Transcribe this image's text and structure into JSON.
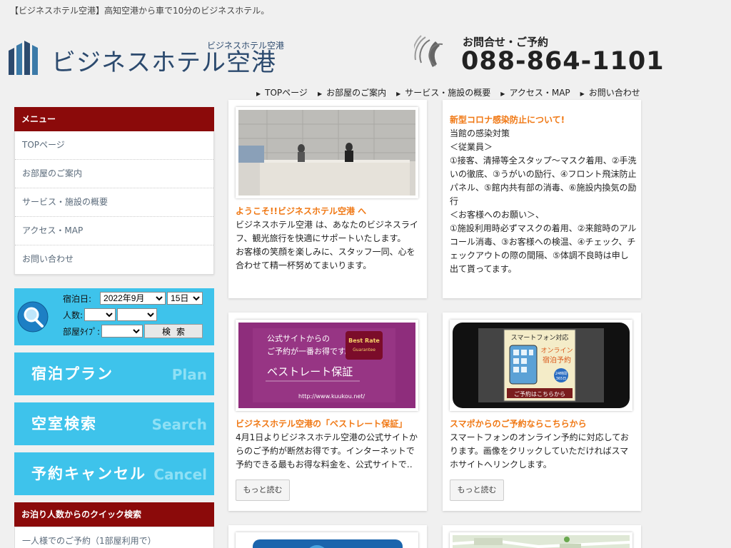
{
  "site": {
    "tagline": "【ビジネスホテル空港】高知空港から車で10分のビジネスホテル。",
    "logo_sub": "ビジネスホテル空港",
    "logo_name": "ビジネスホテル空港",
    "phone_label": "お問合せ・ご予約",
    "phone_number": "088-864-1101"
  },
  "topnav": [
    {
      "label": "TOPページ"
    },
    {
      "label": "お部屋のご案内"
    },
    {
      "label": "サービス・施設の概要"
    },
    {
      "label": "アクセス・MAP"
    },
    {
      "label": "お問い合わせ"
    }
  ],
  "sidebar": {
    "menu_head": "メニュー",
    "items": [
      {
        "label": "TOPページ"
      },
      {
        "label": "お部屋のご案内"
      },
      {
        "label": "サービス・施設の概要"
      },
      {
        "label": "アクセス・MAP"
      },
      {
        "label": "お問い合わせ"
      }
    ]
  },
  "search": {
    "date_label": "宿泊日:",
    "month_value": "2022年9月",
    "day_value": "15日",
    "people_label": "人数:",
    "room_label": "部屋ﾀｲﾌﾟ:",
    "button": "検索"
  },
  "big_buttons": [
    {
      "jp": "宿泊プラン",
      "en": "Plan"
    },
    {
      "jp": "空室検索",
      "en": "Search"
    },
    {
      "jp": "予約キャンセル",
      "en": "Cancel"
    }
  ],
  "quick": {
    "head": "お泊り人数からのクイック検索",
    "items": [
      {
        "label": "一人様でのご予約（1部屋利用で）"
      }
    ]
  },
  "cards": {
    "welcome": {
      "title": "ようこそ!!ビジネスホテル空港 へ",
      "body": "ビジネスホテル空港 は、あなたのビジネスライフ、観光旅行を快適にサポートいたします。\nお客様の笑顔を楽しみに、スタッフ一同、心を合わせて精一杯努めてまいります。"
    },
    "notice": {
      "title": "新型コロナ感染防止について!",
      "body": "当館の感染対策\n＜従業員＞\n①接客、清掃等全スタップ～マスク着用、②手洗いの徹底、③うがいの励行、④フロント飛沫防止パネル、⑤館内共有部の消毒、⑥施設内換気の励行\n＜お客様へのお願い＞、\n①施設利用時必ずマスクの着用、②来館時のアルコール消毒、③お客様への検温、④チェック、チェックアウトの際の間隔、⑤体調不良時は申し出て貰ってます。"
    },
    "bestrate": {
      "title": "ビジネスホテル空港の「ベストレート保証」",
      "body": "4月1日よりビジネスホテル空港の公式サイトからのご予約が断然お得です。インターネットで予約できる最もお得な料金を、公式サイトで‥",
      "more": "もっと読む",
      "img_line1": "公式サイトからの",
      "img_line2": "ご予約が一番お得です。",
      "img_main": "ベストレート保証",
      "img_url": "http://www.kuukou.net/",
      "badge1": "Best Rate",
      "badge2": "Guarantee"
    },
    "smartphone": {
      "title": "スマポからのご予約ならこちらから",
      "body": "スマートフォンのオンライン予約に対応しております。画像をクリックしていただければスマホサイトへリンクします。",
      "more": "もっと読む",
      "img_head": "スマートフォン対応",
      "img_sub1": "オンライン",
      "img_sub2": "宿泊予約",
      "img_badge1": "24時間",
      "img_badge2": "365日",
      "img_foot": "ご予約はこちらから"
    }
  },
  "colors": {
    "menu_head": "#8b0a0a",
    "accent_blue": "#3ec3eb",
    "title_orange": "#f07814",
    "brand_navy": "#2c4a6e",
    "bestrate_purple": "#8e2d7c"
  }
}
